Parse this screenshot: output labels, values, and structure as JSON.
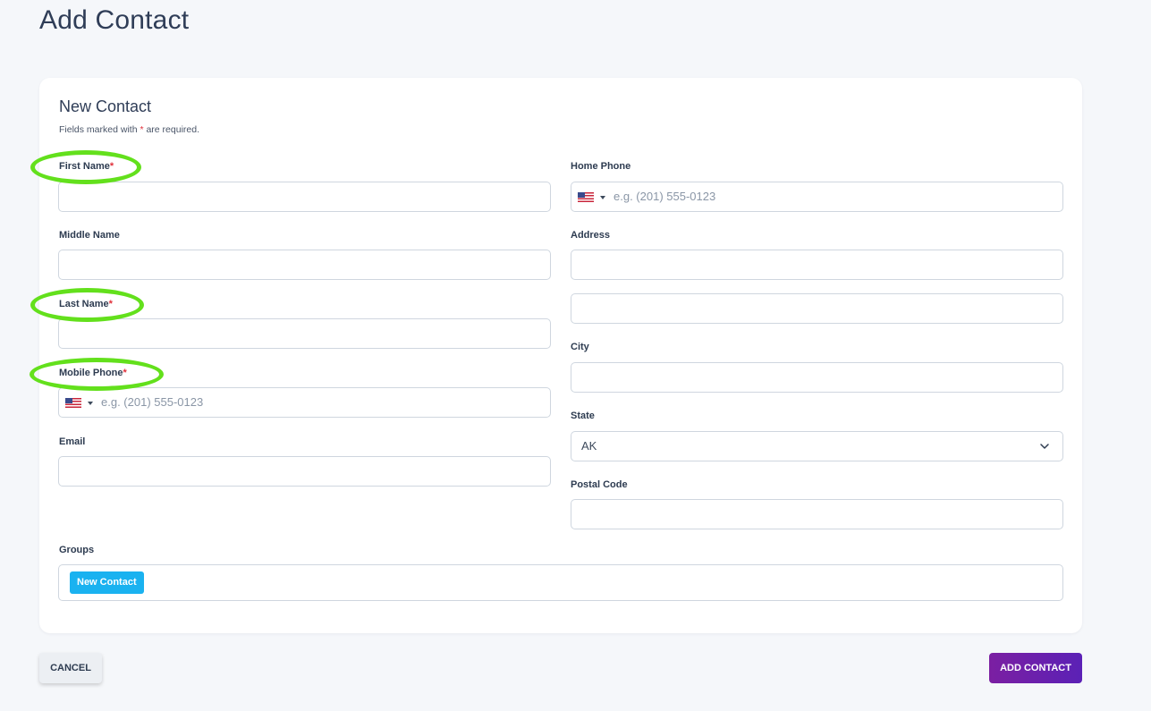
{
  "page": {
    "title": "Add Contact"
  },
  "card": {
    "title": "New Contact",
    "note_prefix": "Fields marked with ",
    "note_star": "*",
    "note_suffix": " are required."
  },
  "fields": {
    "first_name": {
      "label": "First Name",
      "required_mark": "*",
      "value": ""
    },
    "middle_name": {
      "label": "Middle Name",
      "value": ""
    },
    "last_name": {
      "label": "Last Name",
      "required_mark": "*",
      "value": ""
    },
    "mobile_phone": {
      "label": "Mobile Phone",
      "required_mark": "*",
      "placeholder": "e.g. (201) 555-0123",
      "country": "us-flag-icon"
    },
    "email": {
      "label": "Email",
      "value": ""
    },
    "home_phone": {
      "label": "Home Phone",
      "placeholder": "e.g. (201) 555-0123",
      "country": "us-flag-icon"
    },
    "address": {
      "label": "Address",
      "line1": "",
      "line2": ""
    },
    "city": {
      "label": "City",
      "value": ""
    },
    "state": {
      "label": "State",
      "selected": "AK"
    },
    "postal_code": {
      "label": "Postal Code",
      "value": ""
    },
    "groups": {
      "label": "Groups",
      "chips": [
        "New Contact"
      ]
    }
  },
  "actions": {
    "cancel": "CANCEL",
    "add": "ADD CONTACT"
  },
  "colors": {
    "required": "#e0303a",
    "chip": "#1ab2f0",
    "highlight": "#63e01c",
    "add_button_start": "#7b1fa2",
    "add_button_end": "#5b21b6"
  }
}
